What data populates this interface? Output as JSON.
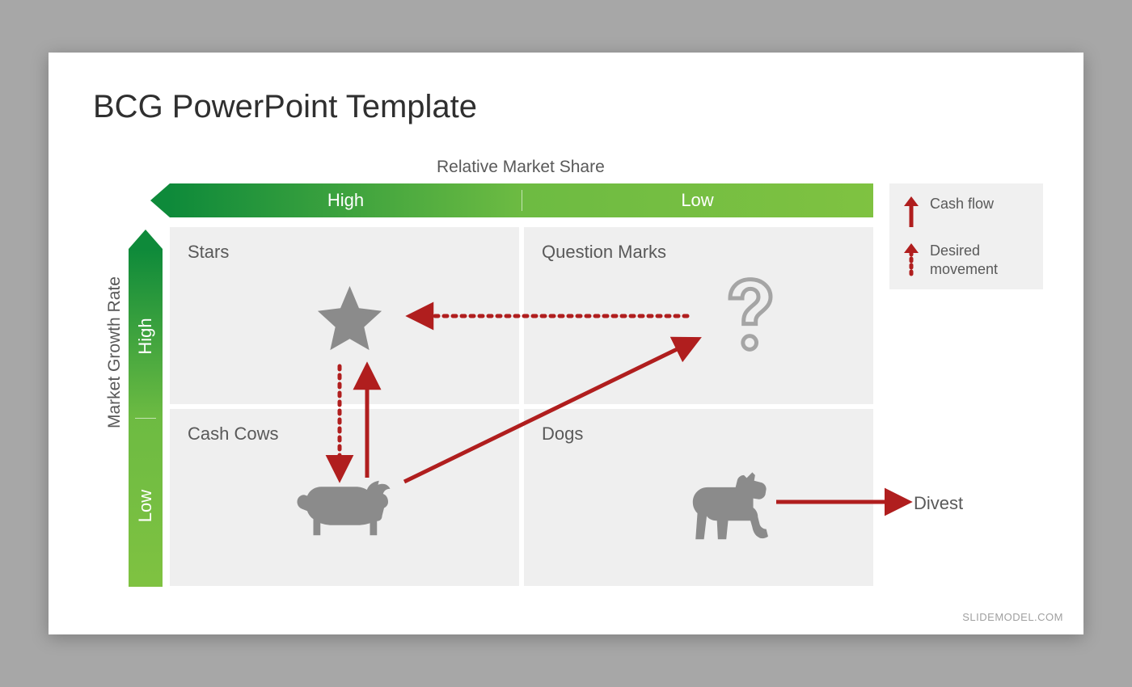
{
  "title": "BCG PowerPoint Template",
  "axes": {
    "x": {
      "title": "Relative Market Share",
      "high": "High",
      "low": "Low"
    },
    "y": {
      "title": "Market Growth Rate",
      "high": "High",
      "low": "Low"
    }
  },
  "quadrants": {
    "stars": "Stars",
    "questionMarks": "Question Marks",
    "cashCows": "Cash Cows",
    "dogs": "Dogs"
  },
  "legend": {
    "cashFlow": "Cash flow",
    "desiredMovement": "Desired movement"
  },
  "divest": "Divest",
  "footer": "SLIDEMODEL.COM",
  "colors": {
    "arrow": "#b01e1e",
    "green1": "#0e8a3a",
    "green2": "#7fc241"
  }
}
